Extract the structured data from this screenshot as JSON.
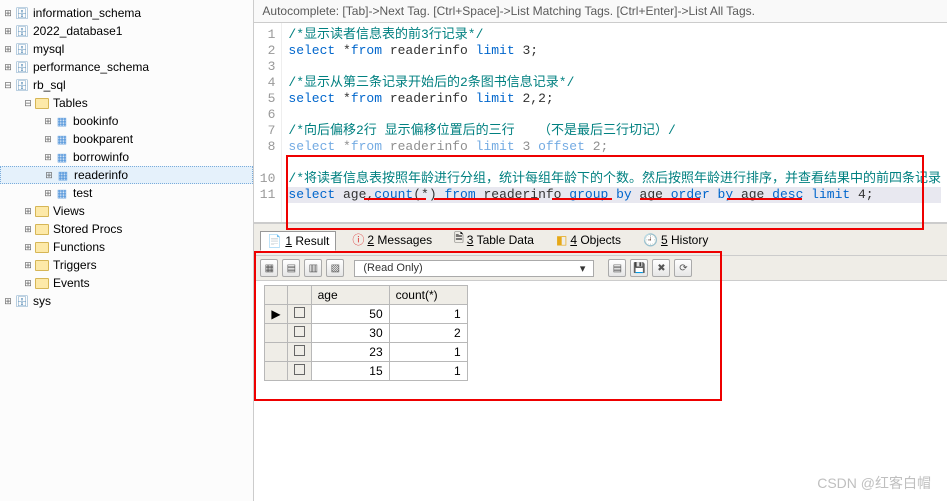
{
  "tree": {
    "l0": [
      "information_schema",
      "2022_database1",
      "mysql",
      "performance_schema",
      "rb_sql"
    ],
    "rb_children": [
      "Tables",
      "Views",
      "Stored Procs",
      "Functions",
      "Triggers",
      "Events"
    ],
    "tables": [
      "bookinfo",
      "bookparent",
      "borrowinfo",
      "readerinfo",
      "test"
    ],
    "last": "sys"
  },
  "hint": "Autocomplete: [Tab]->Next Tag. [Ctrl+Space]->List Matching Tags. [Ctrl+Enter]->List All Tags.",
  "code": {
    "l1": "/*显示读者信息表的前3行记录*/",
    "l2a": "select",
    "l2b": " *",
    "l2c": "from",
    "l2d": " readerinfo ",
    "l2e": "limit",
    "l2f": " 3;",
    "l4": "/*显示从第三条记录开始后的2条图书信息记录*/",
    "l5a": "select",
    "l5b": " *",
    "l5c": "from",
    "l5d": " readerinfo ",
    "l5e": "limit",
    "l5f": " 2,2;",
    "l7": "/*向后偏移2行 显示偏移位置后的三行   （不是最后三行切记）/",
    "l8a": "select",
    "l8b": " *",
    "l8c": "from",
    "l8d": " readerinfo ",
    "l8e": "limit",
    "l8f": " 3 ",
    "l8g": "offset",
    "l8h": " 2;",
    "l10": "/*将读者信息表按照年龄进行分组，统计每组年龄下的个数。然后按照年龄进行排序，并查看结果中的前四条记录",
    "l11a": "select",
    "l11b": " age,",
    "l11c": "count",
    "l11d": "(*) ",
    "l11e": "from",
    "l11f": " readerinfo ",
    "l11g": "group by",
    "l11h": " age ",
    "l11i": "order by",
    "l11j": " age ",
    "l11k": "desc limit",
    "l11l": " 4;"
  },
  "tabs": {
    "t1": "1 Result",
    "t2": "2 Messages",
    "t3": "3 Table Data",
    "t4": "4 Objects",
    "t5": "5 History"
  },
  "readonly": "(Read Only)",
  "resultCols": [
    "age",
    "count(*)"
  ],
  "resultRows": [
    {
      "age": "50",
      "cnt": "1"
    },
    {
      "age": "30",
      "cnt": "2"
    },
    {
      "age": "23",
      "cnt": "1"
    },
    {
      "age": "15",
      "cnt": "1"
    }
  ],
  "watermark": "CSDN @红客白帽"
}
